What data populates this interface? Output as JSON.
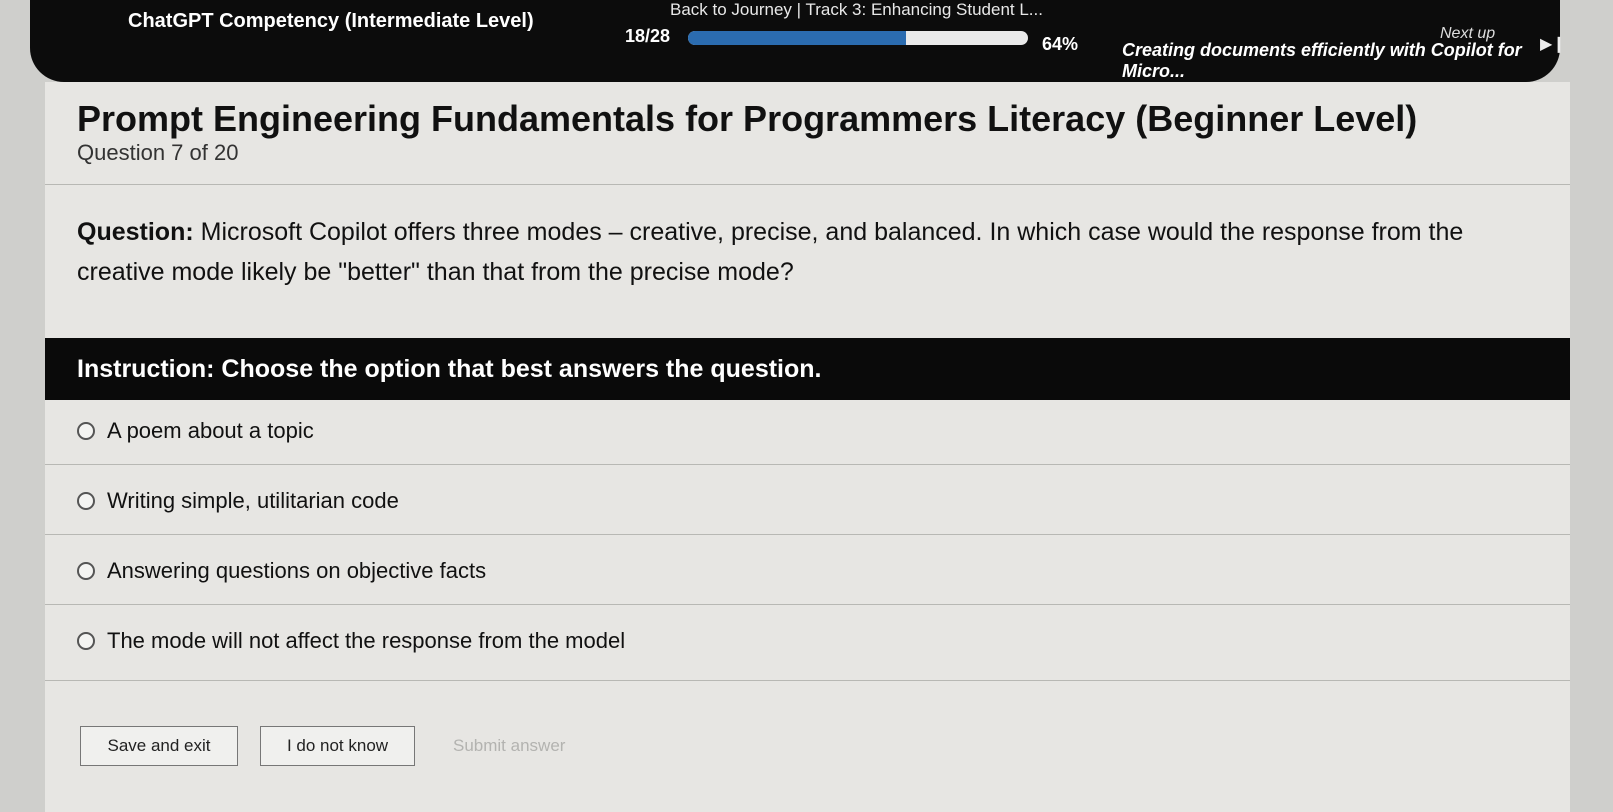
{
  "topbar": {
    "course_title": "ChatGPT Competency (Intermediate Level)",
    "journey_link": "Back to Journey | Track 3: Enhancing Student L...",
    "progress_count": "18/28",
    "progress_percent_label": "64%",
    "progress_fraction": 0.64,
    "next_up_label": "Next up",
    "next_up_title": "Creating documents efficiently with Copilot for Micro...",
    "next_icon": "skip-next-icon"
  },
  "quiz": {
    "title": "Prompt Engineering Fundamentals for Programmers Literacy (Beginner Level)",
    "counter": "Question 7 of 20",
    "question_prefix": "Question:",
    "question_text": " Microsoft Copilot offers three modes – creative, precise, and balanced. In which case would the response from the creative mode likely be \"better\" than that from the precise mode?",
    "instruction": "Instruction: Choose the option that best answers the question.",
    "options": [
      "A poem about a topic",
      "Writing simple, utilitarian code",
      "Answering questions on objective facts",
      "The mode will not affect the response from the model"
    ]
  },
  "buttons": {
    "save_exit": "Save and exit",
    "dont_know": "I do not know",
    "submit": "Submit answer"
  },
  "colors": {
    "topbar_bg": "#0c0c0c",
    "progress_fill": "#2b6cb0",
    "instruction_bg": "#0a0a0a"
  }
}
